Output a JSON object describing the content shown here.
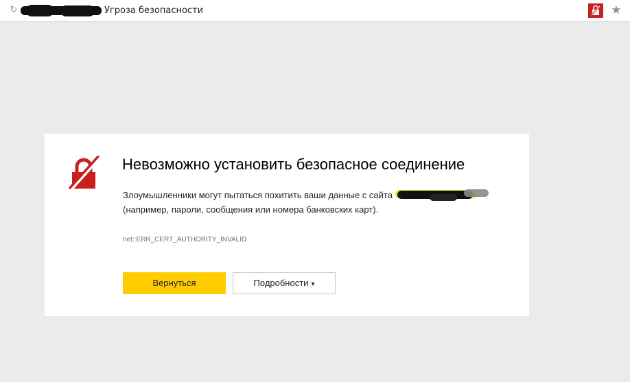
{
  "toolbar": {
    "reload_glyph": "↻",
    "tab_title": "Угроза безопасности",
    "bookmark_glyph": "★"
  },
  "icons": {
    "reload": "reload-icon",
    "security_alert": "broken-lock-icon",
    "bookmark": "star-icon",
    "error_lock": "crossed-lock-icon"
  },
  "error_page": {
    "title": "Невозможно установить безопасное соединение",
    "description_line1": "Злоумышленники могут пытаться похитить ваши данные с сайта",
    "description_line2": "(например, пароли, сообщения или номера банковских карт).",
    "error_code": "net::ERR_CERT_AUTHORITY_INVALID",
    "back_button": "Вернуться",
    "details_button": "Подробности",
    "details_caret": "▾"
  },
  "colors": {
    "page_background": "#ebebeb",
    "card_background": "#ffffff",
    "alert_red": "#c9201d",
    "primary_button": "#ffcc00",
    "redaction_marker": "#111111",
    "highlight_yellow": "#e8e000"
  }
}
